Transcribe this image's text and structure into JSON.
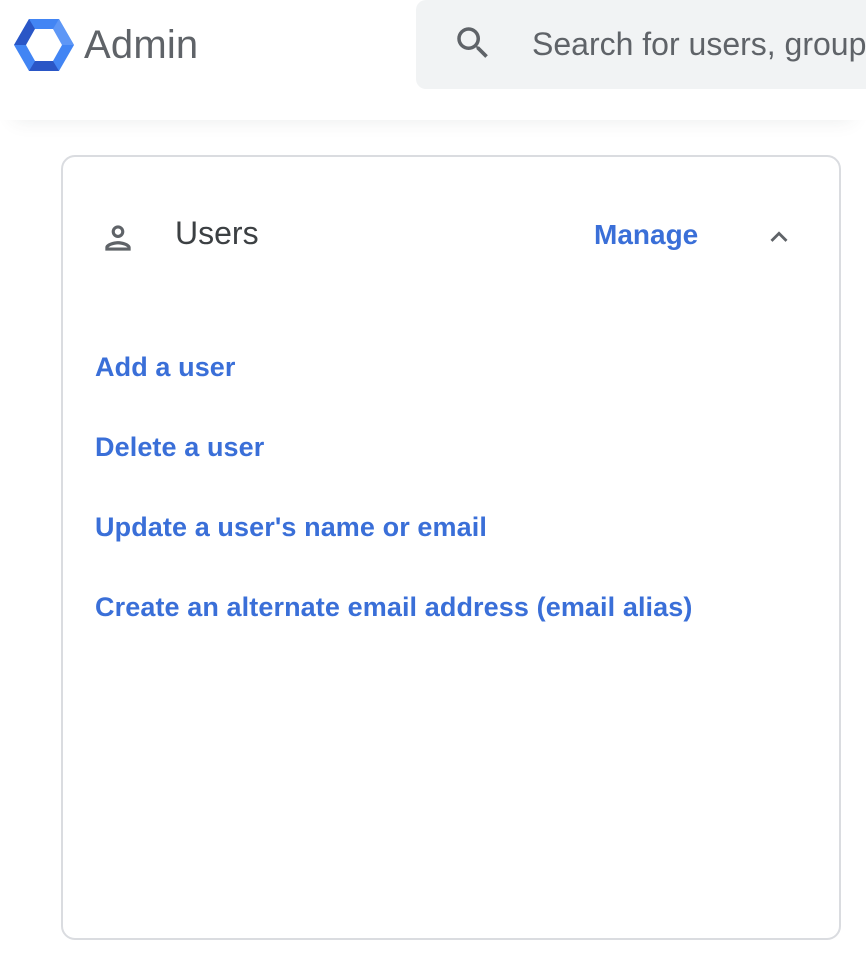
{
  "header": {
    "app_name": "Admin",
    "logo_icon": "hexagon-logo-icon",
    "search": {
      "placeholder": "Search for users, groups or settings",
      "icon": "search-icon"
    }
  },
  "users_card": {
    "icon": "person-icon",
    "title": "Users",
    "manage_label": "Manage",
    "collapse_icon": "chevron-up-icon",
    "links": [
      {
        "label": "Add a user"
      },
      {
        "label": "Delete a user"
      },
      {
        "label": "Update a user's name or email"
      },
      {
        "label": "Create an alternate email address (email alias)"
      }
    ]
  },
  "colors": {
    "link_blue": "#3a6fd8",
    "logo_blue_light": "#4285f4",
    "logo_blue_dark": "#2a56c6",
    "text_grey": "#5f6368",
    "search_bg": "#f1f3f4",
    "card_border": "#dadce0"
  }
}
